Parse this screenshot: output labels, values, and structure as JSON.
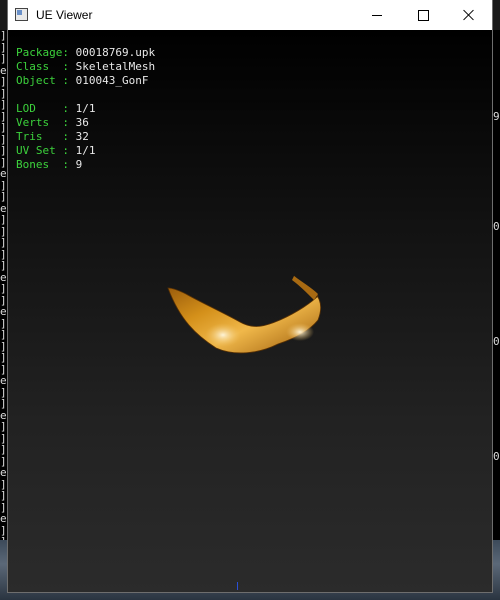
{
  "window": {
    "title": "UE Viewer"
  },
  "info": {
    "package": {
      "label": "Package",
      "sep": ": ",
      "value": "00018769.upk"
    },
    "class": {
      "label": "Class  ",
      "sep": ": ",
      "value": "SkeletalMesh"
    },
    "object": {
      "label": "Object ",
      "sep": ": ",
      "value": "010043_GonF"
    },
    "lod": {
      "label": "LOD    ",
      "sep": ": ",
      "value": "1/1"
    },
    "verts": {
      "label": "Verts  ",
      "sep": ": ",
      "value": "36"
    },
    "tris": {
      "label": "Tris   ",
      "sep": ": ",
      "value": "32"
    },
    "uvset": {
      "label": "UV Set ",
      "sep": ": ",
      "value": "1/1"
    },
    "bones": {
      "label": "Bones  ",
      "sep": ": ",
      "value": "9"
    }
  },
  "background_console": {
    "left_glyphs": [
      "]",
      "]",
      "]",
      "e",
      "]",
      "]",
      "]",
      "]",
      "]",
      "]",
      "]",
      "]",
      "e",
      "]",
      "]",
      "e",
      "]",
      "]",
      "]",
      "]",
      "]",
      "e",
      "]",
      "]",
      "e",
      "]",
      "]",
      "]",
      "]",
      "]",
      "e",
      "]",
      "]",
      "e",
      "]",
      "]",
      "]",
      "]",
      "e",
      "]",
      "]",
      "]",
      "e",
      "]",
      "]",
      "]",
      "e",
      "]"
    ],
    "right_glyphs": [
      "9",
      "0",
      "0",
      "0",
      "0"
    ]
  },
  "colors": {
    "label_green": "#3cd23c",
    "value_white": "#e8e8e8",
    "mesh_gold": "#d4901a"
  }
}
